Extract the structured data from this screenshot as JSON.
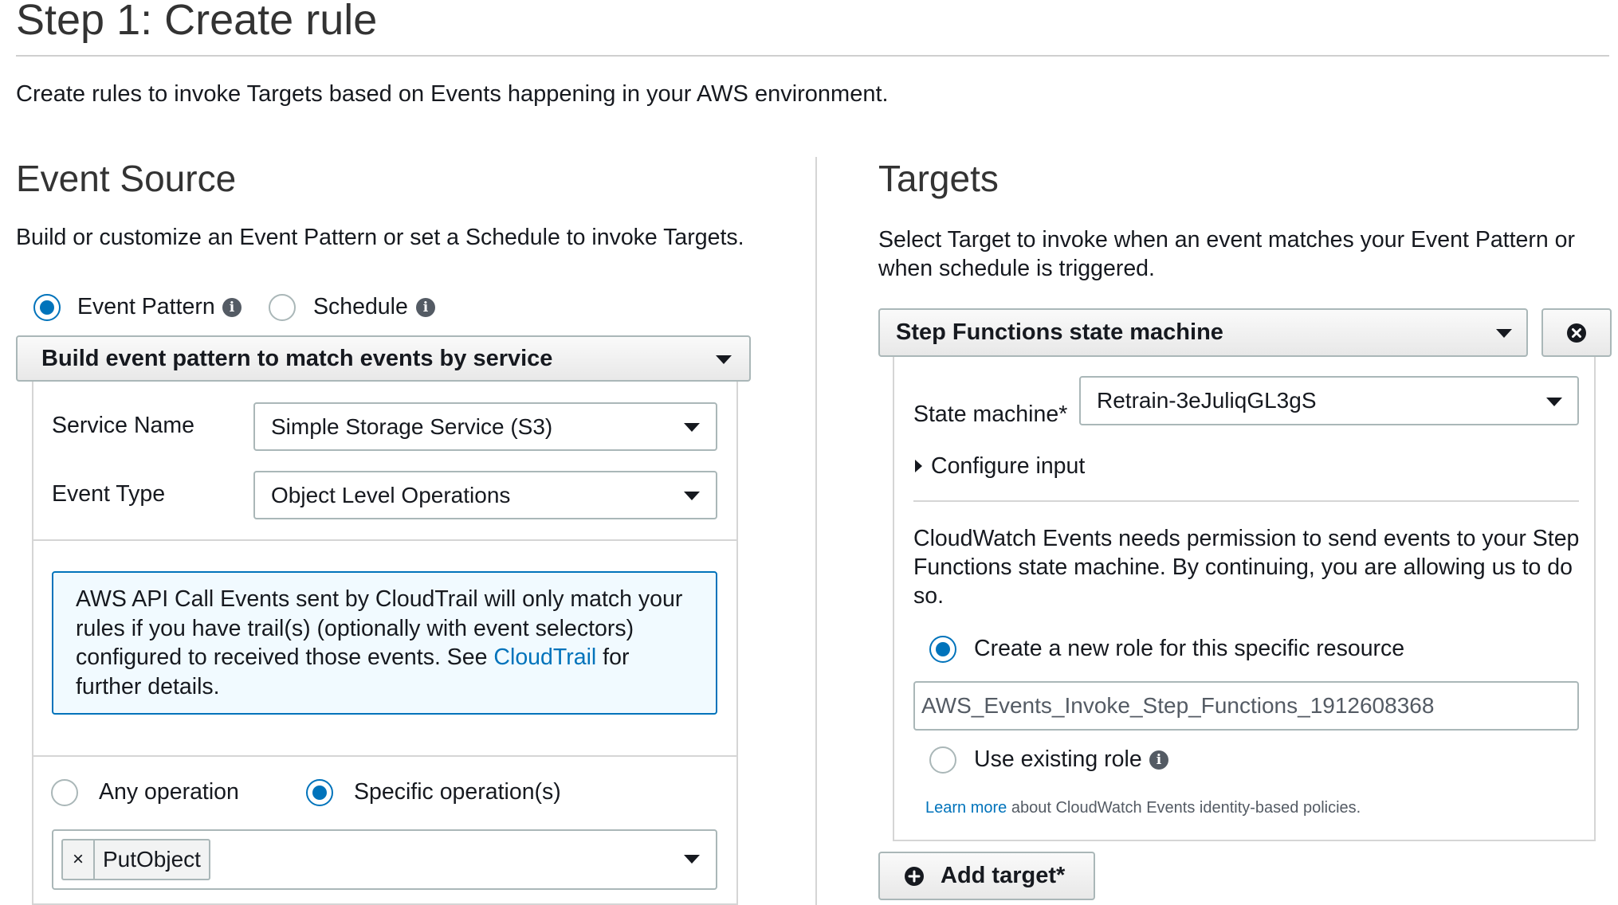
{
  "page": {
    "title": "Step 1: Create rule",
    "intro": "Create rules to invoke Targets based on Events happening in your AWS environment."
  },
  "event_source": {
    "heading": "Event Source",
    "description": "Build or customize an Event Pattern or set a Schedule to invoke Targets.",
    "mode_event_pattern": "Event Pattern",
    "mode_schedule": "Schedule",
    "pattern_builder": "Build event pattern to match events by service",
    "service_name_label": "Service Name",
    "service_name_value": "Simple Storage Service (S3)",
    "event_type_label": "Event Type",
    "event_type_value": "Object Level Operations",
    "notice_text_1": "AWS API Call Events sent by CloudTrail will only match your rules if you have trail(s) (optionally with event selectors) configured to received those events. See",
    "notice_link": "CloudTrail",
    "notice_text_2": "for further details.",
    "any_operation": "Any operation",
    "specific_operations": "Specific operation(s)",
    "operation_token": "PutObject",
    "token_remove": "×"
  },
  "targets": {
    "heading": "Targets",
    "description": "Select Target to invoke when an event matches your Event Pattern or when schedule is triggered.",
    "target_type": "Step Functions state machine",
    "state_machine_label": "State machine*",
    "state_machine_value": "Retrain-3eJuliqGL3gS",
    "configure_input": "Configure input",
    "permission_text": "CloudWatch Events needs permission to send events to your Step Functions state machine. By continuing, you are allowing us to do so.",
    "create_role": "Create a new role for this specific resource",
    "role_name": "AWS_Events_Invoke_Step_Functions_1912608368",
    "use_existing_role": "Use existing role",
    "learn_more": "Learn more",
    "learn_more_suffix": "about CloudWatch Events identity-based policies.",
    "add_target": "Add target*"
  },
  "colors": {
    "accent": "#0073bb",
    "border": "#aab7b8",
    "info_bg": "#f1faff"
  }
}
